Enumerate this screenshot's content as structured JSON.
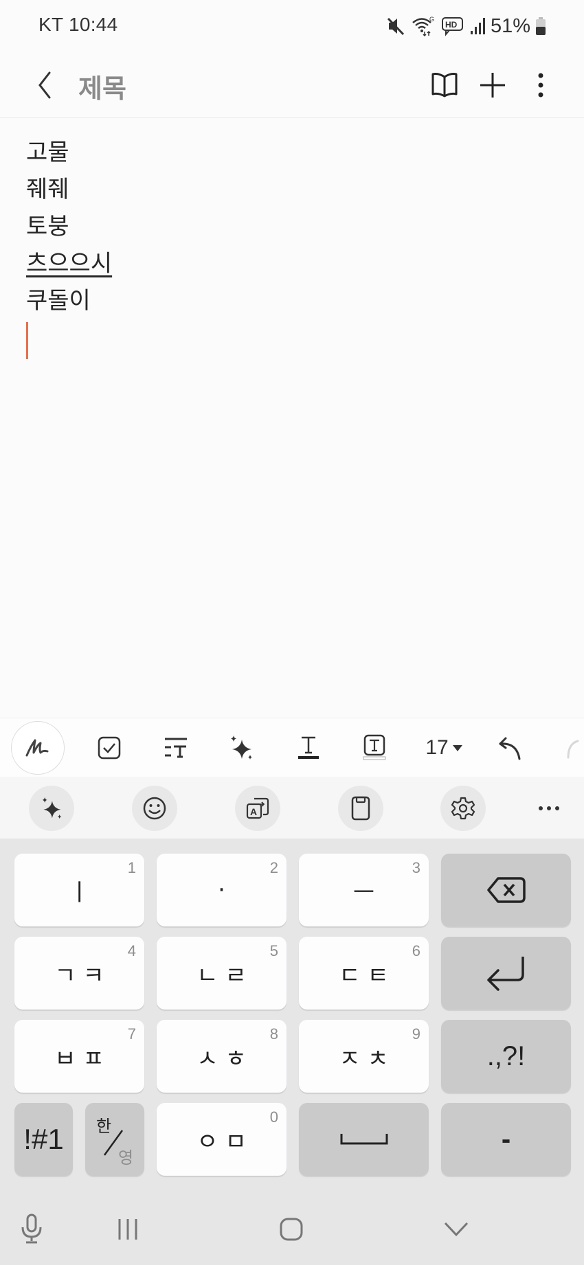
{
  "status_bar": {
    "carrier_time": "KT 10:44",
    "icons": [
      "mute-icon",
      "wifi-icon",
      "hd-voice-icon",
      "signal-icon",
      "battery-icon"
    ],
    "battery_percent": "51%",
    "battery_level": 0.51
  },
  "app_bar": {
    "title": "제목",
    "actions": [
      "reading-mode-icon",
      "add-icon",
      "more-options-icon"
    ]
  },
  "editor": {
    "lines": [
      "고물",
      "줴줴",
      "토붕",
      "츠으으시",
      "쿠돌이"
    ],
    "underlined_line_index": 3,
    "cursor_color": "#e4704d"
  },
  "format_toolbar": {
    "items": [
      "handwriting-pen-icon",
      "checkbox-icon",
      "text-style-icon",
      "ai-sparkle-icon",
      "text-color-icon",
      "text-highlight-icon",
      "font-size",
      "undo-icon",
      "redo-icon"
    ],
    "font_size": "17"
  },
  "keyboard_toolbar": {
    "items": [
      "ai-sparkle-icon",
      "emoji-icon",
      "translate-icon",
      "clipboard-icon",
      "settings-icon",
      "more-icon"
    ]
  },
  "keyboard": {
    "rows": [
      [
        {
          "label": "ㅣ",
          "num": "1",
          "type": "light"
        },
        {
          "label": "·",
          "num": "2",
          "type": "light"
        },
        {
          "label": "ㅡ",
          "num": "3",
          "type": "light"
        },
        {
          "label": "backspace",
          "num": "",
          "type": "dark"
        }
      ],
      [
        {
          "label": "ㄱㅋ",
          "num": "4",
          "type": "light"
        },
        {
          "label": "ㄴㄹ",
          "num": "5",
          "type": "light"
        },
        {
          "label": "ㄷㅌ",
          "num": "6",
          "type": "light"
        },
        {
          "label": "enter",
          "num": "",
          "type": "dark"
        }
      ],
      [
        {
          "label": "ㅂㅍ",
          "num": "7",
          "type": "light"
        },
        {
          "label": "ㅅㅎ",
          "num": "8",
          "type": "light"
        },
        {
          "label": "ㅈㅊ",
          "num": "9",
          "type": "light"
        },
        {
          "label": ".,?!",
          "num": "",
          "type": "dark"
        }
      ],
      [
        {
          "label": "!#1",
          "num": "",
          "type": "dark"
        },
        {
          "label_top": "한",
          "label_bottom": "영",
          "num": "",
          "type": "dark"
        },
        {
          "label": "ㅇㅁ",
          "num": "0",
          "type": "light"
        },
        {
          "label": "space",
          "num": "",
          "type": "dark"
        },
        {
          "label": "-",
          "num": "",
          "type": "dark"
        }
      ]
    ]
  },
  "nav_bar": {
    "items": [
      "voice-input-icon",
      "recent-apps-icon",
      "home-icon",
      "hide-keyboard-icon"
    ]
  }
}
